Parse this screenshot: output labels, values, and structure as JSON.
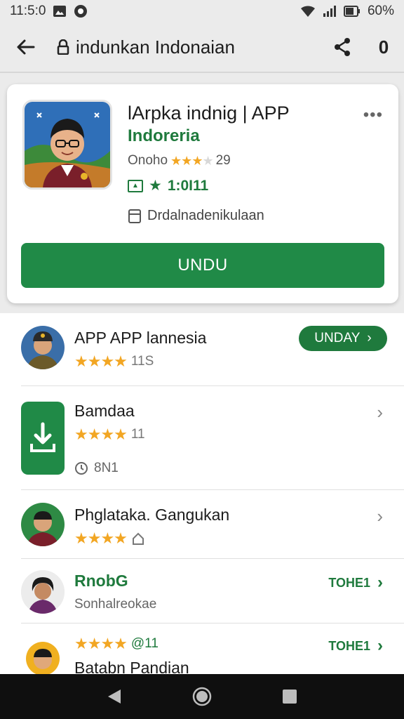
{
  "status": {
    "time": "11:5:0",
    "battery": "60%"
  },
  "app_bar": {
    "title": "indunkan Indonaian",
    "badge": "0"
  },
  "hero": {
    "title": "lArpka indnig | APP",
    "developer": "Indoreria",
    "rating_label": "Onoho",
    "rating_count": "29",
    "downloads": "1:0I11",
    "category": "Drdalnadenikulaan",
    "install_label": "UNDU"
  },
  "list": [
    {
      "name": "APP APP lannesia",
      "stars": "★★★★",
      "meta": "11S",
      "action": "UNDAY"
    },
    {
      "name": "Bamdaa",
      "stars": "★★★★",
      "meta": "11",
      "sub": "8N1"
    },
    {
      "name": "Phglataka. Gangukan",
      "stars": "★★★★",
      "meta": ""
    },
    {
      "name": "RnobG",
      "sub": "Sonhalreokae",
      "action": "TOHE1"
    },
    {
      "stars": "★★★★",
      "meta": "@11",
      "name": "Batabn Pandian",
      "action": "TOHE1"
    }
  ],
  "colors": {
    "accent": "#208a47",
    "accent_dark": "#1f7a3d",
    "star": "#f2a623",
    "background": "#ebebeb",
    "nav": "#0f0f0f"
  }
}
